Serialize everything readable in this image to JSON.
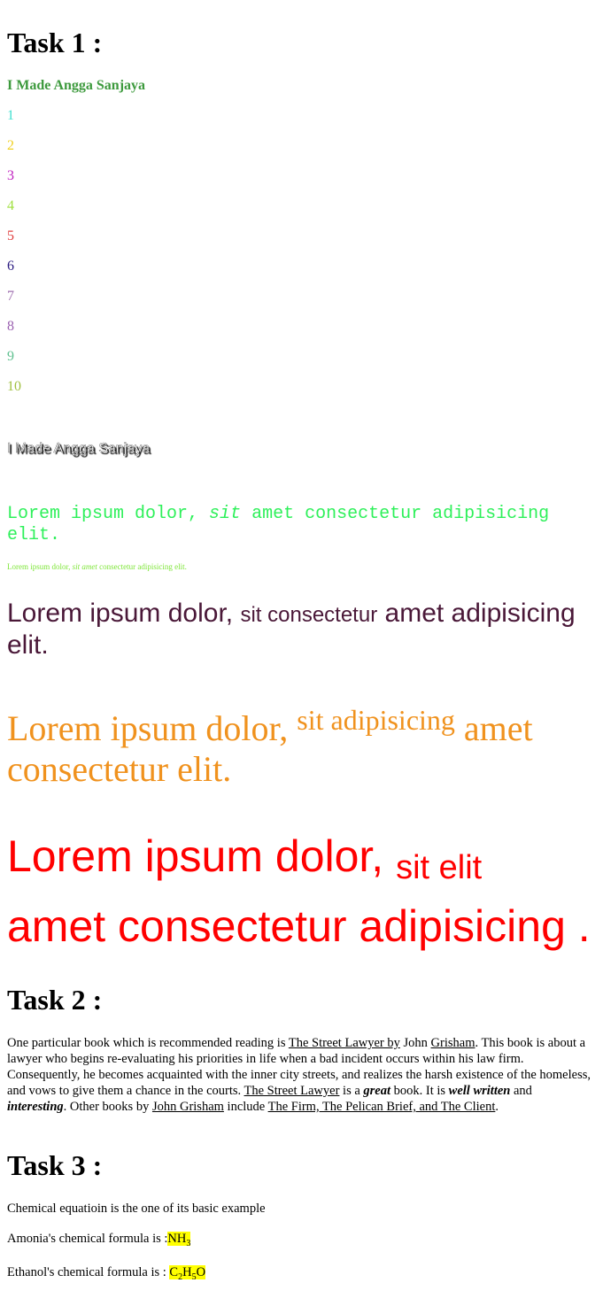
{
  "task1": {
    "heading": "Task 1 :",
    "name_green": "I Made Angga Sanjaya",
    "numbers": [
      {
        "label": "1",
        "color": "#40e0d0"
      },
      {
        "label": "2",
        "color": "#f0d020"
      },
      {
        "label": "3",
        "color": "#c020c0"
      },
      {
        "label": "4",
        "color": "#a0e040"
      },
      {
        "label": "5",
        "color": "#e04040"
      },
      {
        "label": "6",
        "color": "#2a1a80"
      },
      {
        "label": "7",
        "color": "#a070b0"
      },
      {
        "label": "8",
        "color": "#9a60b0"
      },
      {
        "label": "9",
        "color": "#60c090"
      },
      {
        "label": "10",
        "color": "#a0c040"
      }
    ],
    "name_shadow": "I Made Angga Sanjaya",
    "mono_line": {
      "a": "Lorem ipsum dolor, ",
      "b": "sit",
      "c": " amet consectetur adipisicing elit."
    },
    "tiny_line": {
      "a": "Lorem ipsum dolor, ",
      "b": "sit amet",
      "c": " consectetur adipisicing elit."
    },
    "purple_line": {
      "a": "Lorem ipsum dolor, ",
      "b": "sit consectetur",
      "c": " amet adipisicing elit."
    },
    "orange_line": {
      "a": "Lorem ipsum dolor, ",
      "b": "sit adipisicing",
      "c": " amet consectetur elit."
    },
    "red_line": {
      "a": "Lorem ipsum dolor, ",
      "b": "sit elit",
      "c": "amet consectetur adipisicing ."
    }
  },
  "task2": {
    "heading": "Task 2 :",
    "p": {
      "t1": "One particular book which is recommended reading is ",
      "l1": "The Street Lawyer by",
      "t2": " John ",
      "l2": "Grisham",
      "t3": ". This book is about a lawyer who begins re-evaluating his priorities in life when a bad incident occurs within his law firm. Consequently, he becomes acquainted with the inner city streets, and realizes the harsh existence of the homeless, and vows to give them a chance in the courts. ",
      "l3": "The Street Lawyer",
      "t4": " is a ",
      "b1": "great",
      "t5": " book. It is ",
      "b2": "well written",
      "t6": " and ",
      "b3": "interesting",
      "t7": ". Other books by ",
      "l4": "John Grisham",
      "t8": " include ",
      "l5": "The Firm, The Pelican Brief, and The Client",
      "t9": "."
    }
  },
  "task3": {
    "heading": "Task 3 :",
    "intro": "Chemical equatioin is the one of its basic example",
    "amonia_label": "Amonia's chemical formula is :",
    "nh": "NH",
    "nh_sub": "3",
    "ethanol_label": "Ethanol's chemical formula is : ",
    "c": "C",
    "c_sub": "2",
    "h": "H",
    "h_sub": "5",
    "o": "O"
  }
}
